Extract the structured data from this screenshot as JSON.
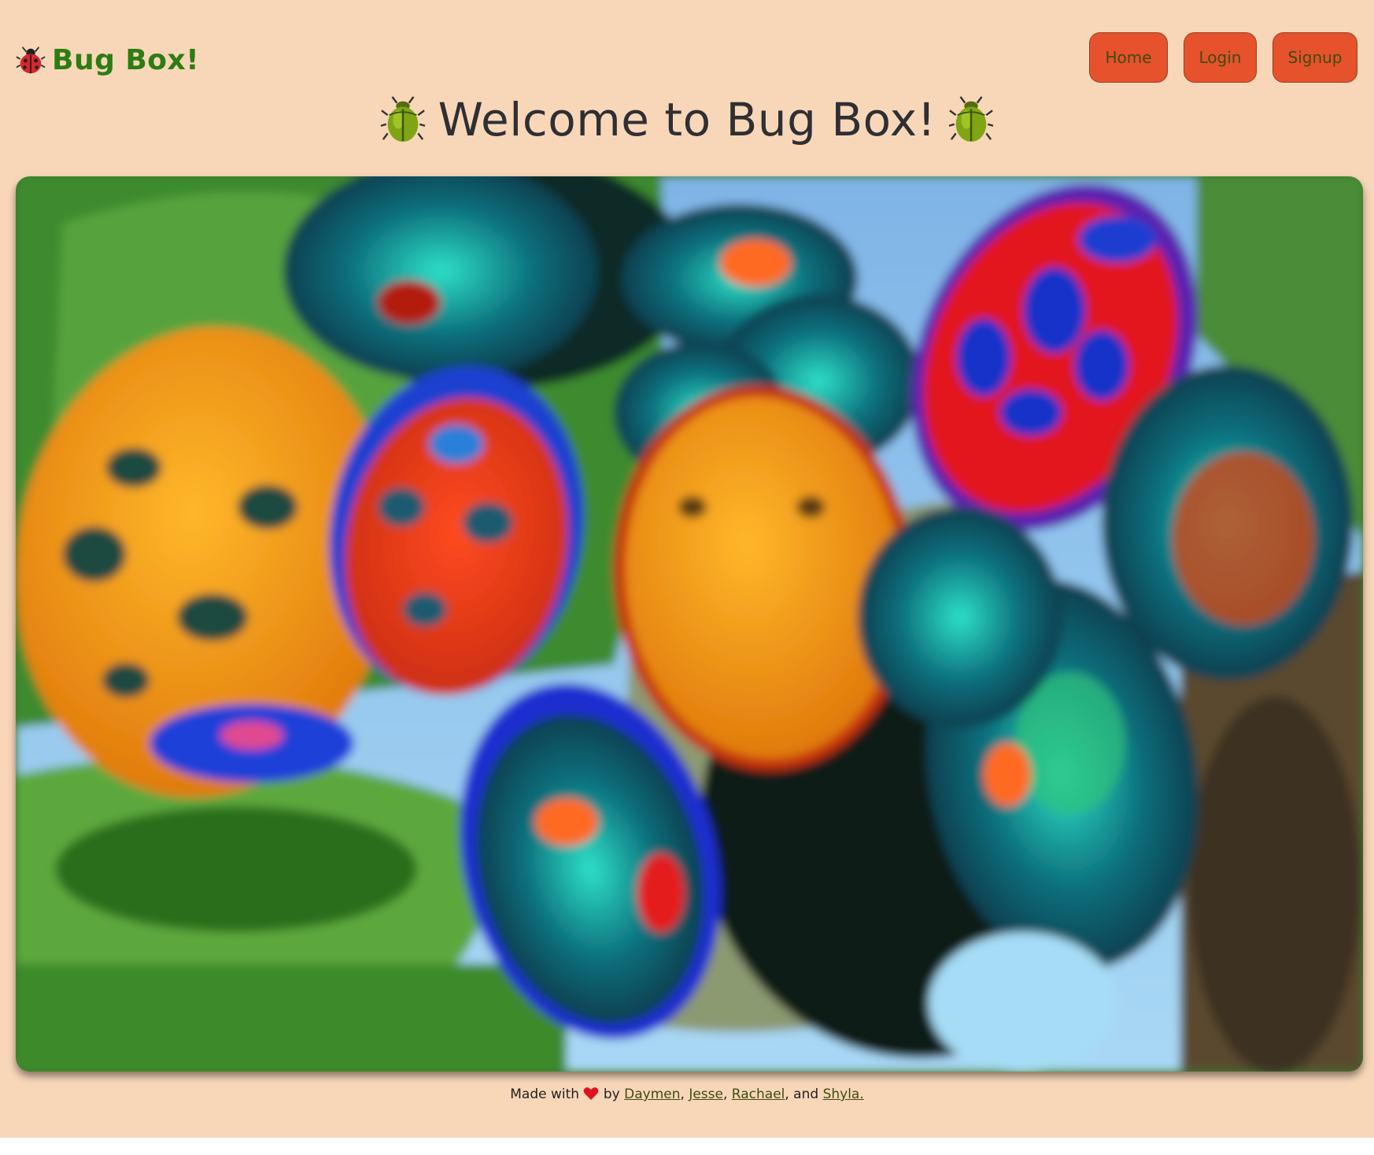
{
  "header": {
    "brand_icon": "ladybug-icon",
    "brand_text": "Bug Box!"
  },
  "nav": {
    "home_label": "Home",
    "login_label": "Login",
    "signup_label": "Signup",
    "button_color": "#e6522c",
    "button_text_color": "#3e4d0c"
  },
  "hero": {
    "left_icon": "beetle-icon",
    "title": "Welcome to Bug Box!",
    "right_icon": "beetle-icon",
    "image_name": "colorful-beetles-photo"
  },
  "footer": {
    "made_with": "Made with",
    "heart_icon": "heart-icon",
    "by": "by",
    "authors": [
      "Daymen",
      "Jesse",
      "Rachael",
      "Shyla."
    ],
    "sep1": ",",
    "sep2": ",",
    "sep3": ", and"
  },
  "colors": {
    "background": "#f8d7b9",
    "brand_green": "#2d7d12",
    "title_color": "#2f2f33"
  }
}
